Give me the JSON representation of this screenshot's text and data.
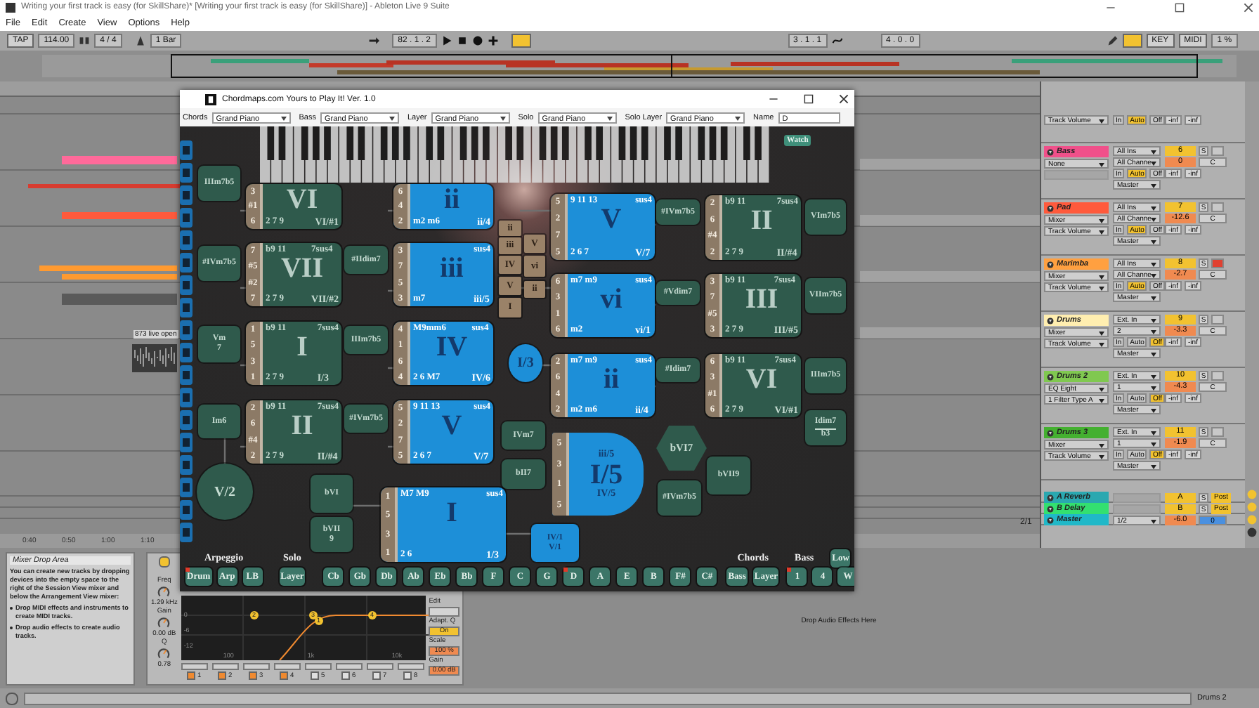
{
  "window": {
    "title": "Writing your first track is easy (for SkillShare)* [Writing your first track is easy (for SkillShare)] - Ableton Live 9 Suite"
  },
  "menu": [
    "File",
    "Edit",
    "Create",
    "View",
    "Options",
    "Help"
  ],
  "transport": {
    "tap": "TAP",
    "tempo": "114.00",
    "signature": "4 / 4",
    "quantize": "1 Bar",
    "position": "82 . 1 . 2",
    "loop_start": "3 . 1 . 1",
    "loop_length": "4 . 0 . 0",
    "key": "KEY",
    "midi": "MIDI",
    "cpu": "1 %"
  },
  "arrangement": {
    "time_labels": [
      "0:40",
      "0:50",
      "1:00",
      "1:10"
    ],
    "clip": "873 live open",
    "zoom": "2/1"
  },
  "mixer": {
    "tracks": [
      {
        "kind": "partial",
        "control": "Track Volume",
        "monitor": [
          {
            "label": "In",
            "selected": false
          },
          {
            "label": "Auto",
            "selected": true
          },
          {
            "label": "Off",
            "selected": false
          }
        ],
        "peaks": [
          "-inf",
          "-inf"
        ]
      },
      {
        "kind": "full",
        "name": "Bass",
        "color": "#f0508a",
        "device": "None",
        "input": "All Ins",
        "channel": "All Channe",
        "monitor": [
          {
            "label": "In",
            "selected": false
          },
          {
            "label": "Auto",
            "selected": true
          },
          {
            "label": "Off",
            "selected": false
          }
        ],
        "output": "Master",
        "number": "6",
        "volume": "0",
        "pan": "C",
        "solo": "S",
        "armed": false,
        "peaks": [
          "-inf",
          "-inf"
        ]
      },
      {
        "kind": "full",
        "name": "Pad",
        "color": "#ff5a3c",
        "device": "Mixer",
        "control": "Track Volume",
        "input": "All Ins",
        "channel": "All Channe",
        "monitor": [
          {
            "label": "In",
            "selected": false
          },
          {
            "label": "Auto",
            "selected": true
          },
          {
            "label": "Off",
            "selected": false
          }
        ],
        "output": "Master",
        "number": "7",
        "volume": "-12.6",
        "pan": "C",
        "solo": "S",
        "armed": false,
        "peaks": [
          "-inf",
          "-inf"
        ]
      },
      {
        "kind": "full",
        "name": "Marimba",
        "color": "#ffa040",
        "device": "Mixer",
        "control": "Track Volume",
        "input": "All Ins",
        "channel": "All Channe",
        "monitor": [
          {
            "label": "In",
            "selected": false
          },
          {
            "label": "Auto",
            "selected": true
          },
          {
            "label": "Off",
            "selected": false
          }
        ],
        "output": "Master",
        "number": "8",
        "volume": "-2.7",
        "pan": "C",
        "solo": "S",
        "armed": true,
        "peaks": [
          "-inf",
          "-inf"
        ]
      },
      {
        "kind": "full",
        "name": "Drums",
        "color": "#ffeeb0",
        "device": "Mixer",
        "control": "Track Volume",
        "input": "Ext. In",
        "channel": "2",
        "monitor": [
          {
            "label": "In",
            "selected": false
          },
          {
            "label": "Auto",
            "selected": false
          },
          {
            "label": "Off",
            "selected": true
          }
        ],
        "output": "Master",
        "number": "9",
        "volume": "-3.3",
        "pan": "C",
        "solo": "S",
        "armed": false,
        "peaks": [
          "-inf",
          "-inf"
        ]
      },
      {
        "kind": "full",
        "name": "Drums 2",
        "color": "#80c850",
        "device": "EQ Eight",
        "control": "1 Filter Type A",
        "input": "Ext. In",
        "channel": "1",
        "monitor": [
          {
            "label": "In",
            "selected": false
          },
          {
            "label": "Auto",
            "selected": false
          },
          {
            "label": "Off",
            "selected": true
          }
        ],
        "output": "Master",
        "number": "10",
        "volume": "-4.3",
        "pan": "C",
        "solo": "S",
        "armed": false,
        "peaks": [
          "-inf",
          "-inf"
        ]
      },
      {
        "kind": "full",
        "name": "Drums 3",
        "color": "#44b030",
        "device": "Mixer",
        "control": "Track Volume",
        "input": "Ext. In",
        "channel": "1",
        "monitor": [
          {
            "label": "In",
            "selected": false
          },
          {
            "label": "Auto",
            "selected": false
          },
          {
            "label": "Off",
            "selected": true
          }
        ],
        "output": "Master",
        "number": "11",
        "volume": "-1.9",
        "pan": "C",
        "solo": "S",
        "armed": false,
        "peaks": [
          "-inf",
          "-inf"
        ]
      },
      {
        "kind": "return",
        "name": "A Reverb",
        "color": "#2aa8b0",
        "number": "A",
        "solo": "S",
        "mode": "Post"
      },
      {
        "kind": "return",
        "name": "B Delay",
        "color": "#33e070",
        "number": "B",
        "solo": "S",
        "mode": "Post"
      },
      {
        "kind": "master",
        "name": "Master",
        "color": "#20b8c8",
        "channel": "1/2",
        "volume": "-6.0",
        "pan": "0"
      }
    ]
  },
  "chordmaps": {
    "title": "Chordmaps.com Yours to Play It!  Ver. 1.0",
    "instruments": [
      {
        "label": "Chords",
        "value": "Grand Piano"
      },
      {
        "label": "Bass",
        "value": "Grand Piano"
      },
      {
        "label": "Layer",
        "value": "Grand Piano"
      },
      {
        "label": "Solo",
        "value": "Grand Piano"
      },
      {
        "label": "Solo Layer",
        "value": "Grand Piano"
      },
      {
        "label": "Name",
        "value": "D"
      }
    ],
    "watch": "Watch",
    "nodes": [
      {
        "kind": "tile",
        "color": "#2f5a4c",
        "notes": [
          "3",
          "#1",
          "6"
        ],
        "numeral": "VI",
        "slash": "VI/#1",
        "bottom": "2 7 9"
      },
      {
        "kind": "tile",
        "color": "#2f5a4c",
        "notes": [
          "7",
          "#5",
          "#2",
          "7"
        ],
        "numeral": "VII",
        "top": "b9 11",
        "sus": "7sus4",
        "slash": "VII/#2",
        "bottom": "2 7 9"
      },
      {
        "kind": "tile",
        "color": "#2f5a4c",
        "notes": [
          "1",
          "5",
          "3",
          "1"
        ],
        "numeral": "I",
        "top": "b9 11",
        "sus": "7sus4",
        "slash": "I/3",
        "bottom": "2 7 9"
      },
      {
        "kind": "tile",
        "color": "#2f5a4c",
        "notes": [
          "2",
          "6",
          "#4",
          "2"
        ],
        "numeral": "II",
        "top": "b9 11",
        "sus": "7sus4",
        "slash": "II/#4",
        "bottom": "2 7 9"
      },
      {
        "kind": "tile",
        "color": "#1d8fd8",
        "notes": [
          "6",
          "4",
          "2"
        ],
        "numeral": "ii",
        "slash": "ii/4",
        "bottom": "m2 m6"
      },
      {
        "kind": "tile",
        "color": "#1d8fd8",
        "notes": [
          "3",
          "7",
          "5",
          "3"
        ],
        "numeral": "iii",
        "sus": "sus4",
        "slash": "iii/5",
        "bottom": "m7"
      },
      {
        "kind": "tile",
        "color": "#1d8fd8",
        "notes": [
          "4",
          "1",
          "6",
          "4"
        ],
        "numeral": "IV",
        "top": "M9mm6",
        "sus": "sus4",
        "slash": "IV/6",
        "bottom": "2 6 M7"
      },
      {
        "kind": "tile",
        "color": "#1d8fd8",
        "notes": [
          "5",
          "2",
          "7",
          "5"
        ],
        "numeral": "V",
        "top": "9 11 13",
        "sus": "sus4",
        "slash": "V/7",
        "bottom": "2 6 7"
      },
      {
        "kind": "tile",
        "color": "#1d8fd8",
        "notes": [
          "1",
          "5",
          "3",
          "1"
        ],
        "numeral": "I",
        "top": "M7 M9",
        "sus": "sus4",
        "slash": "1/3",
        "bottom": "2 6"
      },
      {
        "kind": "tile",
        "color": "#1d8fd8",
        "notes": [
          "5",
          "2",
          "7",
          "5"
        ],
        "numeral": "V",
        "top": "9 11 13",
        "sus": "sus4",
        "slash": "V/7",
        "bottom": "2 6 7"
      },
      {
        "kind": "tile",
        "color": "#1d8fd8",
        "notes": [
          "6",
          "3",
          "1",
          "6"
        ],
        "numeral": "vi",
        "top": "m7 m9",
        "sus": "sus4",
        "slash": "vi/1",
        "bottom": "m2"
      },
      {
        "kind": "tile",
        "color": "#1d8fd8",
        "notes": [
          "2",
          "6",
          "4",
          "2"
        ],
        "numeral": "ii",
        "top": "m7 m9",
        "sus": "sus4",
        "slash": "ii/4",
        "bottom": "m2 m6"
      },
      {
        "kind": "tile",
        "color": "#2f5a4c",
        "notes": [
          "2",
          "6",
          "#4",
          "2"
        ],
        "numeral": "II",
        "top": "b9 11",
        "sus": "7sus4",
        "slash": "II/#4",
        "bottom": "2 7 9"
      },
      {
        "kind": "tile",
        "color": "#2f5a4c",
        "notes": [
          "3",
          "7",
          "#5",
          "3"
        ],
        "numeral": "III",
        "top": "b9 11",
        "sus": "7sus4",
        "slash": "III/#5",
        "bottom": "2 7 9"
      },
      {
        "kind": "tile",
        "color": "#2f5a4c",
        "notes": [
          "6",
          "3",
          "#1",
          "6"
        ],
        "numeral": "VI",
        "top": "b9 11",
        "sus": "7sus4",
        "slash": "VI/#1",
        "bottom": "2 7 9"
      },
      {
        "kind": "box",
        "color": "#2f5a4c",
        "label": "IIIm7b5"
      },
      {
        "kind": "box",
        "color": "#2f5a4c",
        "label": "#IVm7b5"
      },
      {
        "kind": "box",
        "color": "#2f5a4c",
        "label": "Vm",
        "sub": "7"
      },
      {
        "kind": "box",
        "color": "#2f5a4c",
        "label": "Im6"
      },
      {
        "kind": "box",
        "color": "#2f5a4c",
        "label": "#IIdim7"
      },
      {
        "kind": "box",
        "color": "#2f5a4c",
        "label": "IIIm7b5"
      },
      {
        "kind": "box",
        "color": "#2f5a4c",
        "label": "#IVm7b5"
      },
      {
        "kind": "circle",
        "color": "#2f5a4c",
        "label": "V/2"
      },
      {
        "kind": "box",
        "color": "#2f5a4c",
        "label": "bVI"
      },
      {
        "kind": "box",
        "color": "#2f5a4c",
        "label": "bVII",
        "sub": "9"
      },
      {
        "kind": "key",
        "color": "#9a8268",
        "label": "ii"
      },
      {
        "kind": "key",
        "color": "#9a8268",
        "label": "iii"
      },
      {
        "kind": "key",
        "color": "#9a8268",
        "label": "IV"
      },
      {
        "kind": "key",
        "color": "#9a8268",
        "label": "V"
      },
      {
        "kind": "key",
        "color": "#9a8268",
        "label": "I"
      },
      {
        "kind": "key",
        "color": "#9a8268",
        "label": "V"
      },
      {
        "kind": "key",
        "color": "#9a8268",
        "label": "vi"
      },
      {
        "kind": "key",
        "color": "#9a8268",
        "label": "ii"
      },
      {
        "kind": "circle",
        "color": "#1d8fd8",
        "label": "I/3"
      },
      {
        "kind": "box",
        "color": "#2f5a4c",
        "label": "IVm7"
      },
      {
        "kind": "box",
        "color": "#2f5a4c",
        "label": "bII7"
      },
      {
        "kind": "octagon",
        "color": "#1d8fd8",
        "notes": [
          "5",
          "3",
          "1",
          "5"
        ],
        "top": "iii/5",
        "label": "I/5",
        "sub": "IV/5"
      },
      {
        "kind": "hexagon",
        "color": "#2f5a4c",
        "label": "bVI7"
      },
      {
        "kind": "box",
        "color": "#2f5a4c",
        "label": "bVII9"
      },
      {
        "kind": "box",
        "color": "#2f5a4c",
        "label": "#IVm7b5"
      },
      {
        "kind": "box",
        "color": "#1d8fd8",
        "label": "IV/1",
        "sub": "V/1"
      },
      {
        "kind": "box",
        "color": "#2f5a4c",
        "label": "#IVm7b5"
      },
      {
        "kind": "box",
        "color": "#2f5a4c",
        "label": "#Vdim7"
      },
      {
        "kind": "box",
        "color": "#2f5a4c",
        "label": "#Idim7"
      },
      {
        "kind": "box",
        "color": "#2f5a4c",
        "label": "VIm7b5"
      },
      {
        "kind": "box",
        "color": "#2f5a4c",
        "label": "VIIm7b5"
      },
      {
        "kind": "box",
        "color": "#2f5a4c",
        "label": "IIIm7b5"
      },
      {
        "kind": "fraction",
        "color": "#2f5a4c",
        "label": "Idim7",
        "sub": "b3"
      }
    ],
    "controls": [
      {
        "label": "Arpeggio",
        "buttons": [
          {
            "label": "Drum",
            "on": true
          },
          {
            "label": "Arp",
            "on": false
          },
          {
            "label": "LB",
            "on": false
          }
        ]
      },
      {
        "label": "Solo",
        "buttons": [
          {
            "label": "Layer",
            "on": false
          }
        ]
      },
      {
        "buttons": [
          {
            "label": "Cb",
            "on": false
          },
          {
            "label": "Gb",
            "on": false
          },
          {
            "label": "Db",
            "on": false
          },
          {
            "label": "Ab",
            "on": false
          },
          {
            "label": "Eb",
            "on": false
          },
          {
            "label": "Bb",
            "on": false
          },
          {
            "label": "F",
            "on": false
          },
          {
            "label": "C",
            "on": false
          },
          {
            "label": "G",
            "on": false
          },
          {
            "label": "D",
            "on": true
          },
          {
            "label": "A",
            "on": false
          },
          {
            "label": "E",
            "on": false
          },
          {
            "label": "B",
            "on": false
          },
          {
            "label": "F#",
            "on": false
          },
          {
            "label": "C#",
            "on": false
          }
        ]
      },
      {
        "label": "Chords",
        "buttons": [
          {
            "label": "Bass",
            "on": false
          },
          {
            "label": "Layer",
            "on": false
          }
        ]
      },
      {
        "label": "Bass",
        "extra": {
          "label": "Low",
          "on": false
        },
        "buttons": [
          {
            "label": "1",
            "on": true
          },
          {
            "label": "4",
            "on": false
          },
          {
            "label": "W",
            "on": false
          }
        ]
      }
    ]
  },
  "info": {
    "title": "Mixer Drop Area",
    "text": "You can create new tracks by dropping devices into the empty space to the right of the Session View mixer and below the Arrangement View mixer:",
    "bullets": [
      "Drop MIDI effects and instruments to create MIDI tracks.",
      "Drop audio effects to create audio tracks."
    ]
  },
  "eq": {
    "freq_label": "Freq",
    "freq": "1.29 kHz",
    "gain_label": "Gain",
    "gain": "0.00 dB",
    "q_label": "Q",
    "q": "0.78",
    "edit": "Edit",
    "adapt_label": "Adapt. Q",
    "adapt": "On",
    "adapt_on": true,
    "scale_label": "Scale",
    "scale": "100 %",
    "out_gain_label": "Gain",
    "out_gain": "0.00 dB",
    "y_labels": [
      "0",
      "-6",
      "-12"
    ],
    "x_labels": [
      "100",
      "1k",
      "10k"
    ],
    "points": [
      "2",
      "3",
      "1",
      "4"
    ],
    "bands": [
      {
        "label": "1",
        "on": true
      },
      {
        "label": "2",
        "on": true
      },
      {
        "label": "3",
        "on": true
      },
      {
        "label": "4",
        "on": true
      },
      {
        "label": "5",
        "on": false
      },
      {
        "label": "6",
        "on": false
      },
      {
        "label": "7",
        "on": false
      },
      {
        "label": "8",
        "on": false
      }
    ]
  },
  "drop_hint": "Drop Audio Effects Here",
  "status": {
    "track": "Drums 2"
  }
}
